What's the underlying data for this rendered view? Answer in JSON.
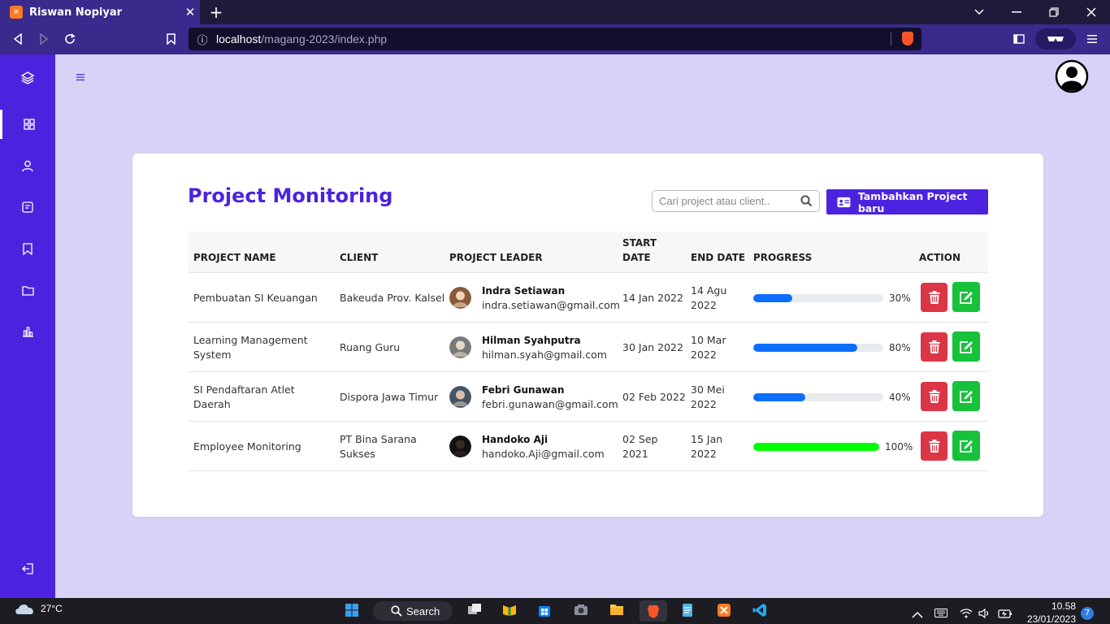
{
  "browser": {
    "tab_title": "Riswan Nopiyar",
    "url_host": "localhost",
    "url_path": "/magang-2023/index.php"
  },
  "page": {
    "title": "Project Monitoring",
    "search_placeholder": "Cari project atau client..",
    "add_button": "Tambahkan Project baru"
  },
  "table": {
    "headers": [
      "PROJECT NAME",
      "CLIENT",
      "PROJECT LEADER",
      "START DATE",
      "END DATE",
      "PROGRESS",
      "ACTION"
    ],
    "rows": [
      {
        "project": "Pembuatan SI Keuangan",
        "client": "Bakeuda Prov. Kalsel",
        "leader_name": "Indra Setiawan",
        "leader_email": "indra.setiawan@gmail.com",
        "start": "14 Jan 2022",
        "end": "14 Agu 2022",
        "progress": 30,
        "progress_label": "30%",
        "bar_color": "#0d6efd"
      },
      {
        "project": "Learning Management System",
        "client": "Ruang Guru",
        "leader_name": "Hilman Syahputra",
        "leader_email": "hilman.syah@gmail.com",
        "start": "30 Jan 2022",
        "end": "10 Mar 2022",
        "progress": 80,
        "progress_label": "80%",
        "bar_color": "#0d6efd"
      },
      {
        "project": "SI Pendaftaran Atlet Daerah",
        "client": "Dispora Jawa Timur",
        "leader_name": "Febri Gunawan",
        "leader_email": "febri.gunawan@gmail.com",
        "start": "02 Feb 2022",
        "end": "30 Mei 2022",
        "progress": 40,
        "progress_label": "40%",
        "bar_color": "#0d6efd"
      },
      {
        "project": "Employee Monitoring",
        "client": "PT Bina Sarana Sukses",
        "leader_name": "Handoko Aji",
        "leader_email": "handoko.Aji@gmail.com",
        "start": "02 Sep 2021",
        "end": "15 Jan 2022",
        "progress": 100,
        "progress_label": "100%",
        "bar_color": "#00ff00"
      }
    ]
  },
  "taskbar": {
    "temperature": "27°C",
    "search": "Search",
    "time": "10.58",
    "date": "23/01/2023",
    "notifications": "7"
  },
  "colors": {
    "accent": "#4b23df",
    "background": "#d8d2f6",
    "delete": "#dc3545",
    "edit": "#17c13a"
  }
}
